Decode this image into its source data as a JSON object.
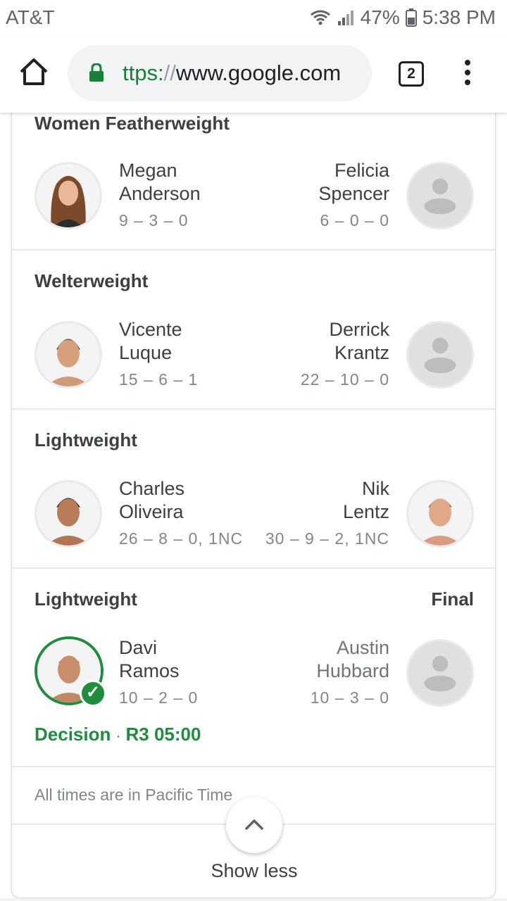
{
  "status": {
    "carrier": "AT&T",
    "battery": "47%",
    "time": "5:38 PM"
  },
  "browser": {
    "url_scheme": "ttps:",
    "url_sep": "//",
    "url_host": "www.google.com",
    "tab_count": "2"
  },
  "fights": [
    {
      "division": "Women Featherweight",
      "fighter1": {
        "first": "Megan",
        "last": "Anderson",
        "record": "9 – 3 – 0"
      },
      "fighter2": {
        "first": "Felicia",
        "last": "Spencer",
        "record": "6 – 0 – 0"
      }
    },
    {
      "division": "Welterweight",
      "fighter1": {
        "first": "Vicente",
        "last": "Luque",
        "record": "15 – 6 – 1"
      },
      "fighter2": {
        "first": "Derrick",
        "last": "Krantz",
        "record": "22 – 10 – 0"
      }
    },
    {
      "division": "Lightweight",
      "fighter1": {
        "first": "Charles",
        "last": "Oliveira",
        "record": "26 – 8 – 0, 1NC"
      },
      "fighter2": {
        "first": "Nik",
        "last": "Lentz",
        "record": "30 – 9 – 2, 1NC"
      }
    },
    {
      "division": "Lightweight",
      "status": "Final",
      "fighter1": {
        "first": "Davi",
        "last": "Ramos",
        "record": "10 – 2 – 0"
      },
      "fighter2": {
        "first": "Austin",
        "last": "Hubbard",
        "record": "10 – 3 – 0"
      },
      "result_method": "Decision",
      "result_dot": "·",
      "result_time": "R3 05:00"
    }
  ],
  "footnote": "All times are in Pacific Time",
  "show_less": "Show less",
  "colors": {
    "winner_green": "#1e8e3e",
    "secure_green": "#188038",
    "placeholder_grey": "#e0e0e0"
  }
}
